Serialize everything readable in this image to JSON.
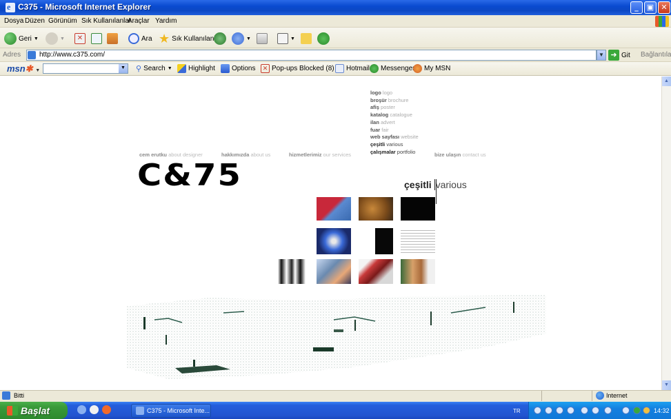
{
  "window": {
    "title": "C375 - Microsoft Internet Explorer"
  },
  "menu": [
    "Dosya",
    "Düzen",
    "Görünüm",
    "Sık Kullanılanlar",
    "Araçlar",
    "Yardım"
  ],
  "toolbar": {
    "back": "Geri",
    "search": "Ara",
    "favorites": "Sık Kullanılanlar"
  },
  "address": {
    "label": "Adres",
    "url": "http://www.c375.com/",
    "go": "Git",
    "links": "Bağlantılar"
  },
  "msnbar": {
    "logo": "msn",
    "search": "Search",
    "highlight": "Highlight",
    "options": "Options",
    "popups": "Pop-ups Blocked (8)",
    "hotmail": "Hotmail",
    "messenger": "Messenger",
    "mymsn": "My MSN"
  },
  "site": {
    "submenu": [
      {
        "tr": "logo",
        "en": "logo"
      },
      {
        "tr": "broşür",
        "en": "brochure"
      },
      {
        "tr": "afiş",
        "en": "poster"
      },
      {
        "tr": "katalog",
        "en": "catalogue"
      },
      {
        "tr": "ilan",
        "en": "advert"
      },
      {
        "tr": "fuar",
        "en": "fair"
      },
      {
        "tr": "web sayfası",
        "en": "website"
      },
      {
        "tr": "çeşitli",
        "en": "various"
      },
      {
        "tr": "çalışmalar",
        "en": "portfolio"
      }
    ],
    "nav": [
      {
        "tr": "cem erutku",
        "en": "about designer"
      },
      {
        "tr": "hakkımızda",
        "en": "about us"
      },
      {
        "tr": "hizmetlerimiz",
        "en": "our services"
      },
      {
        "tr": "bize ulaşın",
        "en": "contact us"
      }
    ],
    "logo_text": "C&75",
    "section": {
      "tr": "çeşitli",
      "en": "various"
    }
  },
  "status": {
    "text": "Bitti",
    "zone": "Internet"
  },
  "taskbar": {
    "start": "Başlat",
    "window_button": "C375 - Microsoft Inte...",
    "lang": "TR",
    "clock": "14:32"
  }
}
